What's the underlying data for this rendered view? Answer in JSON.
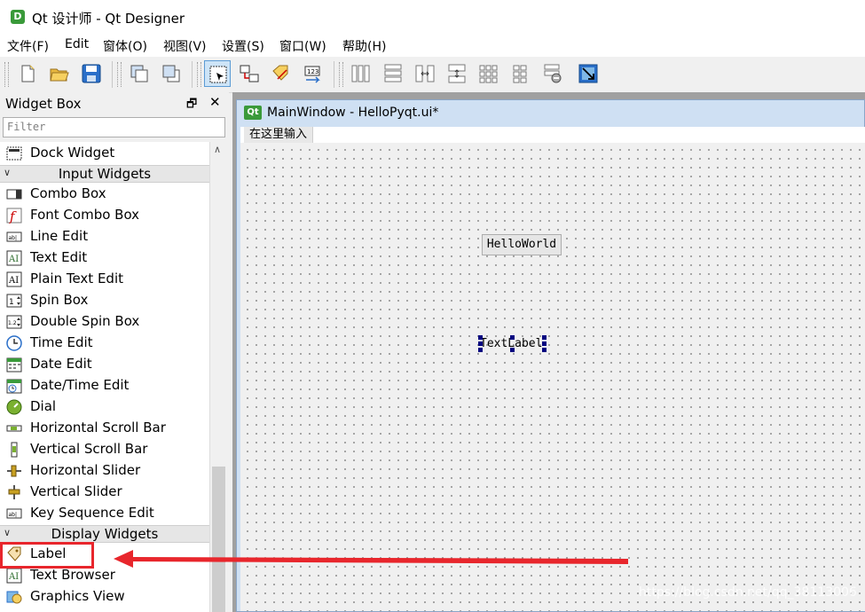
{
  "window": {
    "title": "Qt 设计师 - Qt Designer",
    "icon": "D"
  },
  "menu": [
    "文件(F)",
    "Edit",
    "窗体(O)",
    "视图(V)",
    "设置(S)",
    "窗口(W)",
    "帮助(H)"
  ],
  "toolbar": [
    "new-file-icon",
    "open-folder-icon",
    "save-icon",
    "send-to-back-icon",
    "bring-to-front-icon",
    "edit-widgets-icon",
    "edit-signals-slots-icon",
    "edit-buddies-icon",
    "edit-tab-order-icon",
    "layout-horizontal-icon",
    "layout-vertical-icon",
    "layout-horizontal-splitter-icon",
    "layout-vertical-splitter-icon",
    "layout-grid-icon",
    "layout-form-icon",
    "break-layout-icon",
    "adjust-size-icon"
  ],
  "widget_box": {
    "title": "Widget Box",
    "float_glyph": "🗗",
    "close_glyph": "✕",
    "filter_placeholder": "Filter",
    "rows": [
      {
        "label": "Dock Widget",
        "icon": "dock-widget-icon"
      },
      {
        "category": "Input Widgets"
      },
      {
        "label": "Combo Box",
        "icon": "combo-box-icon"
      },
      {
        "label": "Font Combo Box",
        "icon": "font-combo-box-icon"
      },
      {
        "label": "Line Edit",
        "icon": "line-edit-icon"
      },
      {
        "label": "Text Edit",
        "icon": "text-edit-icon"
      },
      {
        "label": "Plain Text Edit",
        "icon": "plain-text-edit-icon"
      },
      {
        "label": "Spin Box",
        "icon": "spin-box-icon"
      },
      {
        "label": "Double Spin Box",
        "icon": "double-spin-box-icon"
      },
      {
        "label": "Time Edit",
        "icon": "time-edit-icon"
      },
      {
        "label": "Date Edit",
        "icon": "date-edit-icon"
      },
      {
        "label": "Date/Time Edit",
        "icon": "date-time-edit-icon"
      },
      {
        "label": "Dial",
        "icon": "dial-icon"
      },
      {
        "label": "Horizontal Scroll Bar",
        "icon": "horizontal-scroll-bar-icon"
      },
      {
        "label": "Vertical Scroll Bar",
        "icon": "vertical-scroll-bar-icon"
      },
      {
        "label": "Horizontal Slider",
        "icon": "horizontal-slider-icon"
      },
      {
        "label": "Vertical Slider",
        "icon": "vertical-slider-icon"
      },
      {
        "label": "Key Sequence Edit",
        "icon": "key-sequence-edit-icon"
      },
      {
        "category": "Display Widgets"
      },
      {
        "label": "Label",
        "icon": "label-icon"
      },
      {
        "label": "Text Browser",
        "icon": "text-browser-icon"
      },
      {
        "label": "Graphics View",
        "icon": "graphics-view-icon"
      }
    ]
  },
  "form": {
    "title": "MainWindow - HelloPyqt.ui*",
    "icon": "Qt",
    "menubar_placeholder": "在这里输入",
    "push_button": "HelloWorld",
    "text_label": "TextLabel"
  },
  "watermark": "https://blog.csdn.net/qq_38113006",
  "colors": {
    "annotation": "#e8262c",
    "selection_handle": "#000080",
    "title_bar_accent": "#3a9a3a"
  }
}
